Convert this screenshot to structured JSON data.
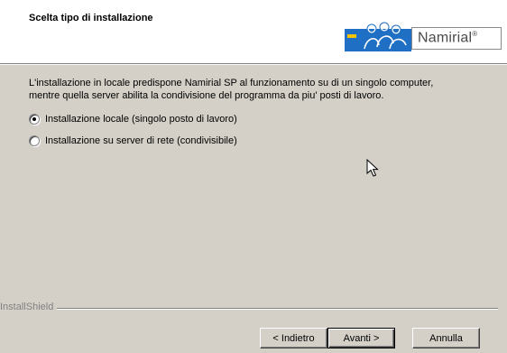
{
  "header": {
    "title": "Scelta tipo di installazione",
    "logo_text": "Namirial",
    "logo_mark": "®"
  },
  "body": {
    "description_line1": "L'installazione in locale predispone Namirial SP al funzionamento su di un singolo computer,",
    "description_line2": "mentre quella server abilita la condivisione del programma da piu' posti di lavoro.",
    "options": [
      {
        "label": "Installazione locale (singolo posto di lavoro)",
        "checked": true
      },
      {
        "label": "Installazione su server di rete (condivisibile)",
        "checked": false
      }
    ]
  },
  "footer": {
    "brand": "InstallShield",
    "back_label": "< Indietro",
    "next_label": "Avanti >",
    "cancel_label": "Annulla"
  },
  "colors": {
    "dialog_bg": "#d4d0c8",
    "logo_blue": "#1f6fc4",
    "logo_accent": "#f5c400"
  }
}
